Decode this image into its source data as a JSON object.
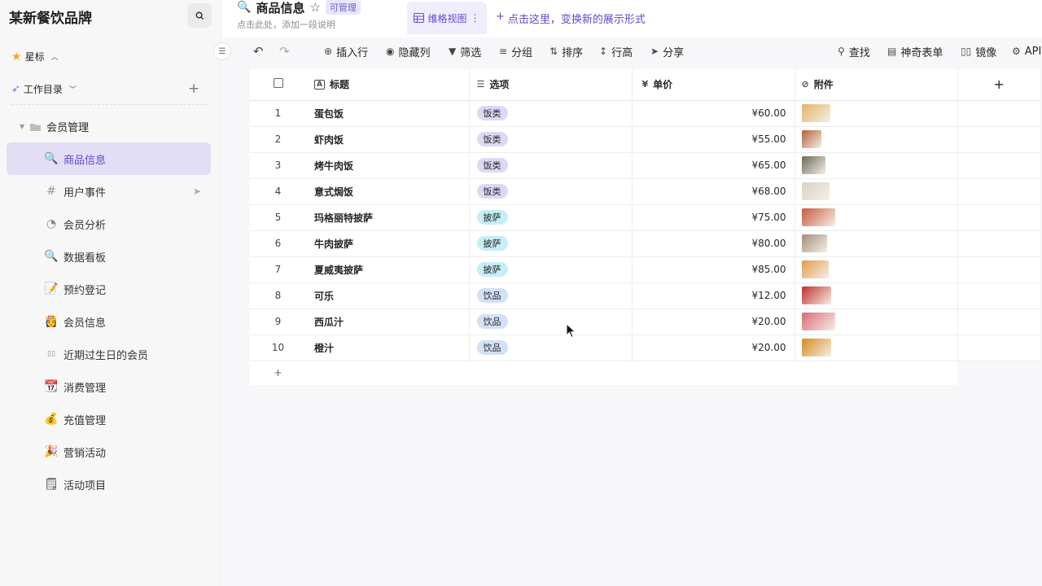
{
  "sidebar": {
    "brand": "某新餐饮品牌",
    "starred": "星标",
    "workspace": "工作目录",
    "folder": "会员管理",
    "items": [
      {
        "label": "商品信息",
        "icon": "🔍",
        "active": true
      },
      {
        "label": "用户事件",
        "icon": "#",
        "active": false
      },
      {
        "label": "会员分析",
        "icon": "◔",
        "active": false
      },
      {
        "label": "数据看板",
        "icon": "🔍",
        "active": false
      },
      {
        "label": "预约登记",
        "icon": "📝",
        "active": false
      },
      {
        "label": "会员信息",
        "icon": "👸",
        "active": false
      },
      {
        "label": "近期过生日的会员",
        "icon": "▯▯",
        "active": false
      },
      {
        "label": "消费管理",
        "icon": "📆",
        "active": false
      },
      {
        "label": "充值管理",
        "icon": "💰",
        "active": false
      },
      {
        "label": "营销活动",
        "icon": "🎉",
        "active": false
      },
      {
        "label": "活动项目",
        "icon": "🗒",
        "active": false
      }
    ]
  },
  "header": {
    "title": "商品信息",
    "badge": "可管理",
    "description": "点击此处，添加一段说明",
    "view_tab": "维格视图",
    "new_view": "点击这里，变换新的展示形式"
  },
  "toolbar": {
    "insert_row": "插入行",
    "hide_columns": "隐藏列",
    "filter": "筛选",
    "group": "分组",
    "sort": "排序",
    "row_height": "行高",
    "share": "分享",
    "find": "查找",
    "magic_form": "神奇表单",
    "mirror": "镜像",
    "api": "API"
  },
  "table": {
    "columns": {
      "title": "标题",
      "options": "选项",
      "price": "单价",
      "attachments": "附件"
    },
    "rows": [
      {
        "no": "1",
        "title": "蛋包饭",
        "option": "饭类",
        "price": "¥60.00",
        "thumb": "#e4b26a"
      },
      {
        "no": "2",
        "title": "虾肉饭",
        "option": "饭类",
        "price": "¥55.00",
        "thumb": "#b5603a"
      },
      {
        "no": "3",
        "title": "烤牛肉饭",
        "option": "饭类",
        "price": "¥65.00",
        "thumb": "#6d6a58"
      },
      {
        "no": "4",
        "title": "意式焗饭",
        "option": "饭类",
        "price": "¥68.00",
        "thumb": "#d9d3c3"
      },
      {
        "no": "5",
        "title": "玛格丽特披萨",
        "option": "披萨",
        "price": "¥75.00",
        "thumb": "#c85a3c"
      },
      {
        "no": "6",
        "title": "牛肉披萨",
        "option": "披萨",
        "price": "¥80.00",
        "thumb": "#a58d78"
      },
      {
        "no": "7",
        "title": "夏威夷披萨",
        "option": "披萨",
        "price": "¥85.00",
        "thumb": "#e49a4c"
      },
      {
        "no": "8",
        "title": "可乐",
        "option": "饮品",
        "price": "¥12.00",
        "thumb": "#c0302a"
      },
      {
        "no": "9",
        "title": "西瓜汁",
        "option": "饮品",
        "price": "¥20.00",
        "thumb": "#d96b78"
      },
      {
        "no": "10",
        "title": "橙汁",
        "option": "饮品",
        "price": "¥20.00",
        "thumb": "#d88a1c"
      }
    ]
  },
  "tag_colors": {
    "饭类": "#dcd9f7",
    "披萨": "#c6eef6",
    "饮品": "#d2e0f8"
  },
  "accent": "#5b4ed1"
}
